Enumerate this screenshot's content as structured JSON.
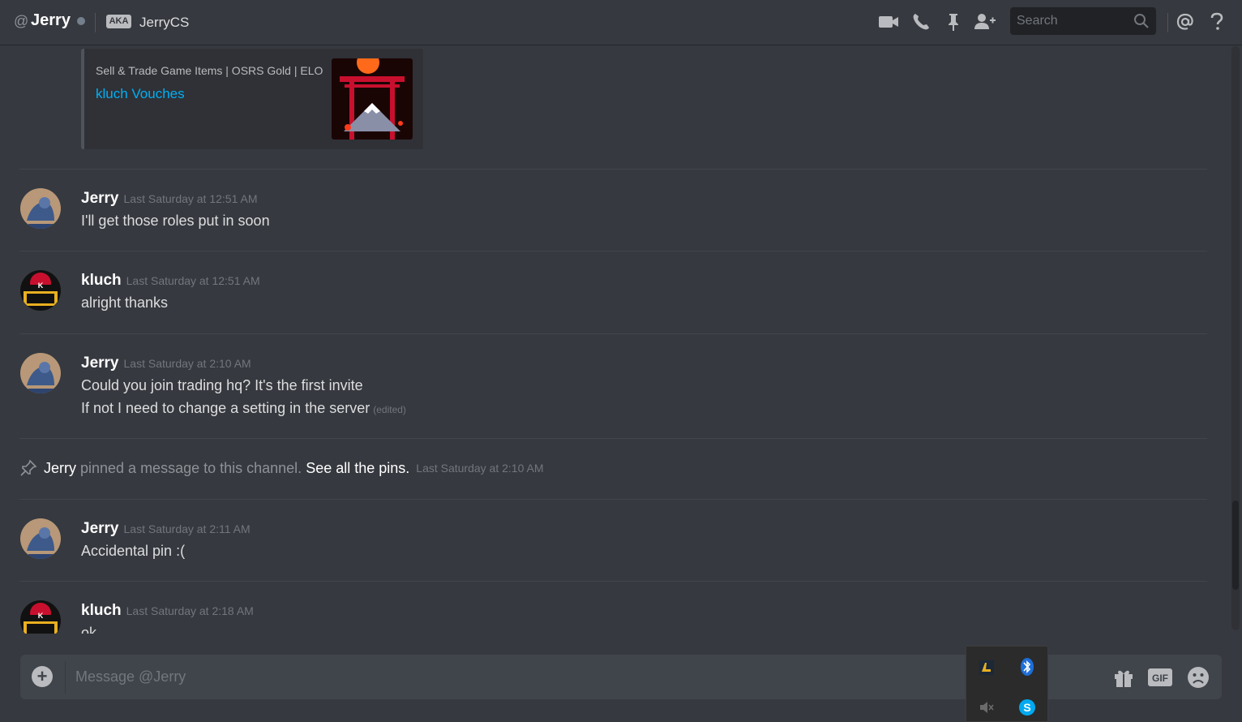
{
  "header": {
    "at": "@",
    "name": "Jerry",
    "aka_badge": "AKA",
    "aka_name": "JerryCS",
    "search_placeholder": "Search",
    "icons": [
      "video-call-icon",
      "voice-call-icon",
      "pin-icon",
      "add-friend-icon",
      "search-icon",
      "mention-icon",
      "help-icon"
    ]
  },
  "embed": {
    "provider": "Sell & Trade Game Items | OSRS Gold | ELO",
    "title": "kluch Vouches"
  },
  "messages": [
    {
      "author": "Jerry",
      "timestamp": "Last Saturday at 12:51 AM",
      "lines": [
        "I'll get those roles put in soon"
      ]
    },
    {
      "author": "kluch",
      "timestamp": "Last Saturday at 12:51 AM",
      "lines": [
        "alright thanks"
      ]
    },
    {
      "author": "Jerry",
      "timestamp": "Last Saturday at 2:10 AM",
      "lines": [
        "Could you join trading hq? It's the first invite",
        "If not I need to change a setting in the server"
      ],
      "edited": "(edited)"
    },
    {
      "author": "Jerry",
      "timestamp": "Last Saturday at 2:11 AM",
      "lines": [
        "Accidental pin :("
      ]
    },
    {
      "author": "kluch",
      "timestamp": "Last Saturday at 2:18 AM",
      "lines": [
        "ok"
      ]
    }
  ],
  "system": {
    "who": "Jerry",
    "text": " pinned a message to this channel. ",
    "link": "See all the pins.",
    "timestamp": "Last Saturday at 2:10 AM"
  },
  "composer": {
    "placeholder": "Message @Jerry",
    "add_label": "+",
    "gif_label": "GIF"
  },
  "colors": {
    "background": "#36393f",
    "link": "#00b0f4",
    "timestamp": "#72767d"
  }
}
